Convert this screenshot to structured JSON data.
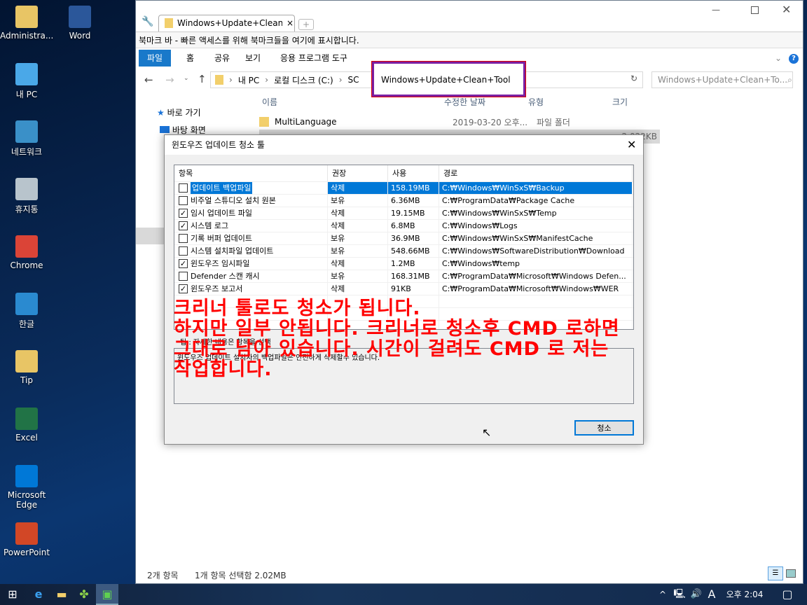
{
  "desktop": {
    "icons": [
      {
        "label": "Administra...",
        "icon": "user-folder-icon",
        "color": "#e8c565"
      },
      {
        "label": "Word",
        "icon": "word-icon",
        "color": "#2b579a"
      },
      {
        "label": "내 PC",
        "icon": "computer-icon",
        "color": "#4aa8e8"
      },
      {
        "label": "네트워크",
        "icon": "network-icon",
        "color": "#3a90c8"
      },
      {
        "label": "휴지통",
        "icon": "recycle-bin-icon",
        "color": "#b8c4cc"
      },
      {
        "label": "Chrome",
        "icon": "chrome-icon",
        "color": "#db4437"
      },
      {
        "label": "한글",
        "icon": "hangul-icon",
        "color": "#2a8ad0"
      },
      {
        "label": "Tip",
        "icon": "folder-icon",
        "color": "#e8c565"
      },
      {
        "label": "Excel",
        "icon": "excel-icon",
        "color": "#217346"
      },
      {
        "label": "Microsoft Edge",
        "icon": "edge-icon",
        "color": "#0078d7"
      },
      {
        "label": "PowerPoint",
        "icon": "powerpoint-icon",
        "color": "#d24726"
      }
    ]
  },
  "explorer": {
    "tab_title": "Windows+Update+Clean+Tool",
    "bookmark_bar": "북마크 바 - 빠른 액세스를 위해 북마크들을 여기에 표시합니다.",
    "ribbon_tabs": [
      "파일",
      "홈",
      "공유",
      "보기",
      "응용 프로그램 도구"
    ],
    "breadcrumb": [
      "내 PC",
      "로컬 디스크 (C:)",
      "SC"
    ],
    "address_current": "Windows+Update+Clean+Tool",
    "search_placeholder": "Windows+Update+Clean+To...",
    "columns": [
      "이름",
      "수정한 날짜",
      "유형",
      "크기"
    ],
    "nav": [
      "바로 가기",
      "바탕 화면"
    ],
    "files": [
      {
        "name": "MultiLanguage",
        "date": "2019-03-20 오후...",
        "type": "파일 폴더",
        "size": ""
      },
      {
        "name": "",
        "date": "",
        "type": "",
        "size": "2,022KB"
      }
    ],
    "status": {
      "count": "2개 항목",
      "selected": "1개 항목 선택함 2.02MB"
    },
    "highlight_color": "#7b1fa2"
  },
  "dialog": {
    "title": "윈도우즈 업데이트 청소 툴",
    "headers": [
      "항목",
      "권장",
      "사용",
      "경로"
    ],
    "rows": [
      {
        "checked": true,
        "name": "업데이트 백업파일",
        "rec": "삭제",
        "size": "158.19MB",
        "path": "C:₩Windows₩WinSxS₩Backup"
      },
      {
        "checked": false,
        "name": "비주얼 스튜디오 설치 원본",
        "rec": "보유",
        "size": "6.36MB",
        "path": "C:₩ProgramData₩Package Cache"
      },
      {
        "checked": true,
        "name": "임시 업데이트 파일",
        "rec": "삭제",
        "size": "19.15MB",
        "path": "C:₩Windows₩WinSxS₩Temp"
      },
      {
        "checked": true,
        "name": "시스템 로그",
        "rec": "삭제",
        "size": "6.8MB",
        "path": "C:₩Windows₩Logs"
      },
      {
        "checked": false,
        "name": "기록 버퍼 업데이트",
        "rec": "보유",
        "size": "36.9MB",
        "path": "C:₩Windows₩WinSxS₩ManifestCache"
      },
      {
        "checked": false,
        "name": "시스템 설치파일 업데이트",
        "rec": "보유",
        "size": "548.66MB",
        "path": "C:₩Windows₩SoftwareDistribution₩Download"
      },
      {
        "checked": true,
        "name": "윈도우즈 임시파일",
        "rec": "삭제",
        "size": "1.2MB",
        "path": "C:₩Windows₩temp"
      },
      {
        "checked": false,
        "name": "Defender 스캔 캐시",
        "rec": "보유",
        "size": "168.31MB",
        "path": "C:₩ProgramData₩Microsoft₩Windows Defen..."
      },
      {
        "checked": true,
        "name": "윈도우즈 보고서",
        "rec": "삭제",
        "size": "91KB",
        "path": "C:₩ProgramData₩Microsoft₩Windows₩WER"
      }
    ],
    "tip": "팁 : 자세한 내용은 항목을 선택",
    "description": "윈도우즈 업데이트 설치자의 백업파일은 안전하게 삭제할수 있습니다.",
    "clean_button": "청소"
  },
  "annotation": [
    "크리너 툴로도 청소가 됩니다.",
    "하지만 일부 안됩니다. 크리너로 청소후 CMD 로하면",
    "그대로 남아 있습니다. 시간이 걸려도 CMD 로 저는",
    "작업합니다."
  ],
  "taskbar": {
    "clock": "오후 2:04",
    "ime": "A"
  }
}
